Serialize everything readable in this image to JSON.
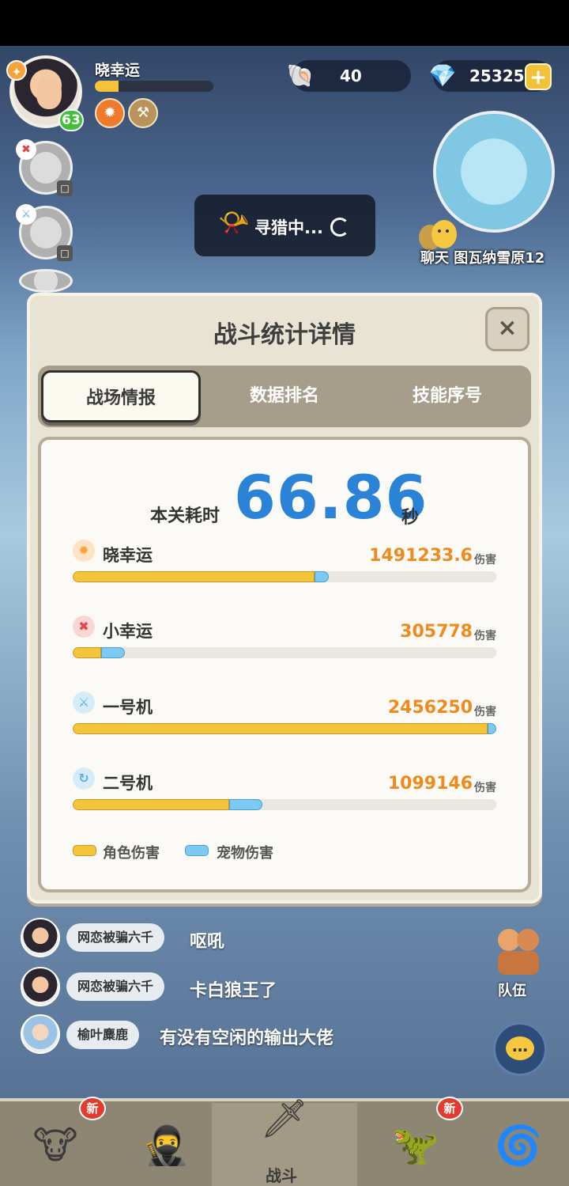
{
  "player": {
    "name": "晓幸运",
    "level": "63",
    "xp_fraction": 0.2
  },
  "currency": [
    {
      "icon": "pearl-shell-icon",
      "value": "40"
    },
    {
      "icon": "crystal-shell-icon",
      "value": "25325"
    }
  ],
  "map": {
    "chat_label": "聊天",
    "location": "图瓦纳雪原12"
  },
  "status": {
    "hunting_text": "寻猎中..."
  },
  "modal": {
    "title": "战斗统计详情",
    "close_label": "×",
    "tabs": [
      {
        "label": "战场情报",
        "active": true
      },
      {
        "label": "数据排名",
        "active": false
      },
      {
        "label": "技能序号",
        "active": false
      }
    ],
    "time": {
      "label": "本关耗时",
      "value": "66.86",
      "unit": "秒"
    },
    "damage_unit": "伤害",
    "rows": [
      {
        "name": "晓幸运",
        "damage": "1491233.6",
        "char_fraction": 0.57,
        "pet_fraction": 0.035,
        "icon": "fire-icon",
        "color": "#f7a33b"
      },
      {
        "name": "小幸运",
        "damage": "305778",
        "char_fraction": 0.068,
        "pet_fraction": 0.055,
        "icon": "cross-icon",
        "color": "#e2464b"
      },
      {
        "name": "一号机",
        "damage": "2456250",
        "char_fraction": 0.98,
        "pet_fraction": 0.02,
        "icon": "sword-icon",
        "color": "#5aaee6"
      },
      {
        "name": "二号机",
        "damage": "1099146",
        "char_fraction": 0.37,
        "pet_fraction": 0.077,
        "icon": "swirl-icon",
        "color": "#5aaee6"
      }
    ],
    "legend": {
      "character": "角色伤害",
      "pet": "宠物伤害",
      "character_color": "#f4c43c",
      "pet_color": "#7ccaf2"
    }
  },
  "chat": [
    {
      "user": "网恋被骗六千",
      "message": "呕吼"
    },
    {
      "user": "网恋被骗六千",
      "message": "卡白狼王了"
    },
    {
      "user": "榆叶麋鹿",
      "message": "有没有空闲的输出大佬"
    }
  ],
  "sidebar": {
    "team_label": "队伍"
  },
  "nav": {
    "battle_label": "战斗",
    "new_badge": "新"
  }
}
